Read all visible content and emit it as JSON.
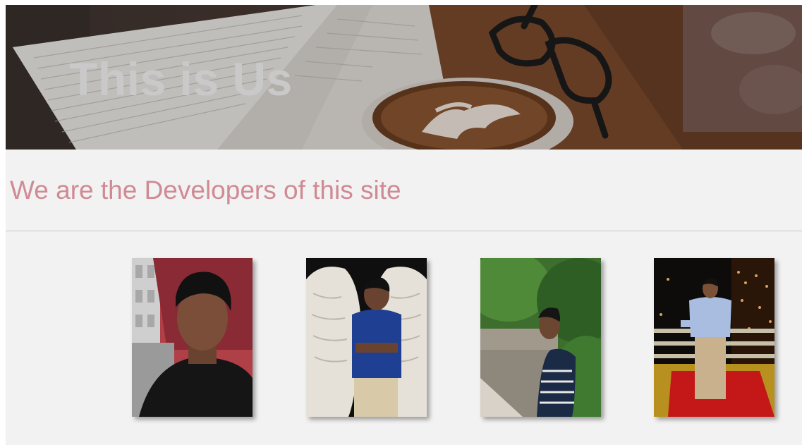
{
  "hero": {
    "title": "This is Us"
  },
  "section": {
    "heading": "We are the Developers of this site"
  },
  "team": [
    {
      "photo": "developer-photo-1"
    },
    {
      "photo": "developer-photo-2"
    },
    {
      "photo": "developer-photo-3"
    },
    {
      "photo": "developer-photo-4"
    }
  ],
  "colors": {
    "heading": "#d08a94",
    "hero_title": "#c9c9c9",
    "background": "#f2f2f2"
  }
}
